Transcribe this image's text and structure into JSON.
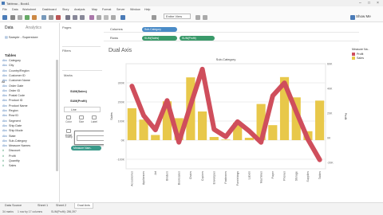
{
  "window": {
    "title": "Tableau - Book1",
    "min": "–",
    "max": "□",
    "close": "×"
  },
  "menu": [
    "File",
    "Data",
    "Worksheet",
    "Dashboard",
    "Story",
    "Analysis",
    "Map",
    "Format",
    "Server",
    "Window",
    "Help"
  ],
  "toolbar": {
    "fit": "Entire View",
    "show_me": "Show Me"
  },
  "sidebar": {
    "tab_data": "Data",
    "tab_analytics": "Analytics",
    "datasource": "Sample - Superstore",
    "tables_heading": "Tables",
    "fields": [
      {
        "label": "Category",
        "type": "dim"
      },
      {
        "label": "City",
        "type": "dim"
      },
      {
        "label": "Country/Region",
        "type": "dim"
      },
      {
        "label": "Customer ID",
        "type": "dim"
      },
      {
        "label": "Customer Name",
        "type": "dim"
      },
      {
        "label": "Order Date",
        "type": "dim"
      },
      {
        "label": "Order ID",
        "type": "dim"
      },
      {
        "label": "Postal Code",
        "type": "dim"
      },
      {
        "label": "Product ID",
        "type": "dim"
      },
      {
        "label": "Product Name",
        "type": "dim"
      },
      {
        "label": "Region",
        "type": "dim"
      },
      {
        "label": "Row ID",
        "type": "dim"
      },
      {
        "label": "Segment",
        "type": "dim"
      },
      {
        "label": "Ship Date",
        "type": "dim"
      },
      {
        "label": "Ship Mode",
        "type": "dim"
      },
      {
        "label": "State",
        "type": "dim"
      },
      {
        "label": "Sub-Category",
        "type": "dim"
      },
      {
        "label": "Measure Names",
        "type": "dim"
      },
      {
        "label": "Discount",
        "type": "meas"
      },
      {
        "label": "Profit",
        "type": "meas"
      },
      {
        "label": "Quantity",
        "type": "meas"
      },
      {
        "label": "Sales",
        "type": "meas"
      }
    ]
  },
  "panes": {
    "pages": "Pages",
    "filters": "Filters",
    "marks": "Marks",
    "marks_all": "All",
    "marks_sales": "SUM(Sales)",
    "marks_profit": "SUM(Profit)",
    "marks_type": "Line",
    "btn_color": "Color",
    "btn_size": "Size",
    "btn_label": "Label",
    "btn_detail": "Detail",
    "btn_tooltip": "Tooltip",
    "measure_pill": "Measure Nam.."
  },
  "shelves": {
    "columns_label": "Columns",
    "rows_label": "Rows",
    "columns_pill": "Sub-Category",
    "rows_pill1": "SUM(Sales)",
    "rows_pill2": "SUM(Profit)"
  },
  "view": {
    "title": "Dual Axis",
    "header": "Sub-Category",
    "left_axis_label": "Sales",
    "right_axis_label": "Profit"
  },
  "legend": {
    "title": "Measure Na..",
    "items": [
      {
        "label": "Profit",
        "color": "#cf4e5c"
      },
      {
        "label": "Sales",
        "color": "#e8c84a"
      }
    ]
  },
  "sheets": [
    "Data Source",
    "Sheet 1",
    "Sheet 2",
    "Dual Axis"
  ],
  "status": {
    "marks": "34 marks",
    "rows": "1 row by 17 columns",
    "sum": "SUM(Profit): 286,397"
  },
  "colors": {
    "bar": "#e8c84a",
    "line": "#cf4e5c",
    "pill_dim": "#4a8bc7",
    "pill_meas": "#3a9a6a"
  },
  "chart_data": {
    "type": "bar",
    "title": "Dual Axis",
    "xlabel": "Sub-Category",
    "categories": [
      "Accessories",
      "Appliances",
      "Art",
      "Binders",
      "Bookcases",
      "Chairs",
      "Copiers",
      "Envelopes",
      "Fasteners",
      "Furnishings",
      "Labels",
      "Machines",
      "Paper",
      "Phones",
      "Storage",
      "Supplies",
      "Tables"
    ],
    "series": [
      {
        "name": "Sales",
        "axis": "left",
        "type": "bar",
        "values": [
          167000,
          107500,
          27100,
          203400,
          114900,
          328400,
          150000,
          16500,
          3000,
          91700,
          12500,
          189200,
          78500,
          330000,
          223800,
          46700,
          206900
        ]
      },
      {
        "name": "Profit",
        "axis": "right",
        "type": "line",
        "values": [
          41900,
          18100,
          6500,
          30200,
          -3500,
          26600,
          55600,
          6900,
          950,
          13100,
          5500,
          -3600,
          34100,
          44500,
          21300,
          -1200,
          -17700
        ]
      }
    ],
    "ylim_left": [
      -150000,
      400000
    ],
    "ylim_right": [
      -25000,
      60000
    ],
    "yticks_left": [
      "-100K",
      "0K",
      "100K",
      "200K",
      "300K"
    ],
    "yticks_right": [
      "-20K",
      "0K",
      "20K",
      "40K",
      "60K"
    ],
    "grid": true,
    "legend": "right"
  }
}
